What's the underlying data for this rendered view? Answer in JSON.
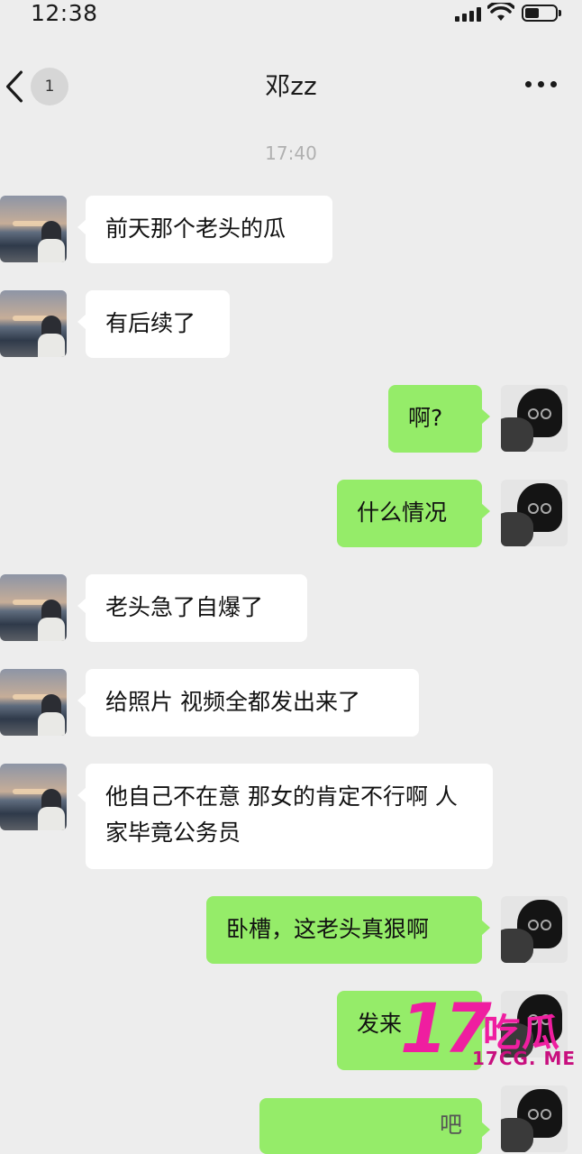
{
  "status_bar": {
    "time": "12:38"
  },
  "nav": {
    "badge": "1",
    "title": "邓zz"
  },
  "chat": {
    "timestamp": "17:40",
    "messages": [
      {
        "side": "left",
        "text": "前天那个老头的瓜"
      },
      {
        "side": "left",
        "text": "有后续了"
      },
      {
        "side": "right",
        "text": "啊?"
      },
      {
        "side": "right",
        "text": "什么情况"
      },
      {
        "side": "left",
        "text": "老头急了自爆了"
      },
      {
        "side": "left",
        "text": "给照片 视频全都发出来了"
      },
      {
        "side": "left",
        "text": "他自己不在意 那女的肯定不行啊 人家毕竟公务员"
      },
      {
        "side": "right",
        "text": "卧槽，这老头真狠啊"
      },
      {
        "side": "right",
        "text": "发来"
      },
      {
        "side": "right",
        "text": "吧"
      }
    ]
  },
  "watermark": {
    "number": "17",
    "name": "吃瓜",
    "url": "17CG. ME",
    "color": "#ef1ea0"
  },
  "colors": {
    "background": "#ededed",
    "incoming_bubble": "#ffffff",
    "outgoing_bubble": "#95ec69"
  }
}
